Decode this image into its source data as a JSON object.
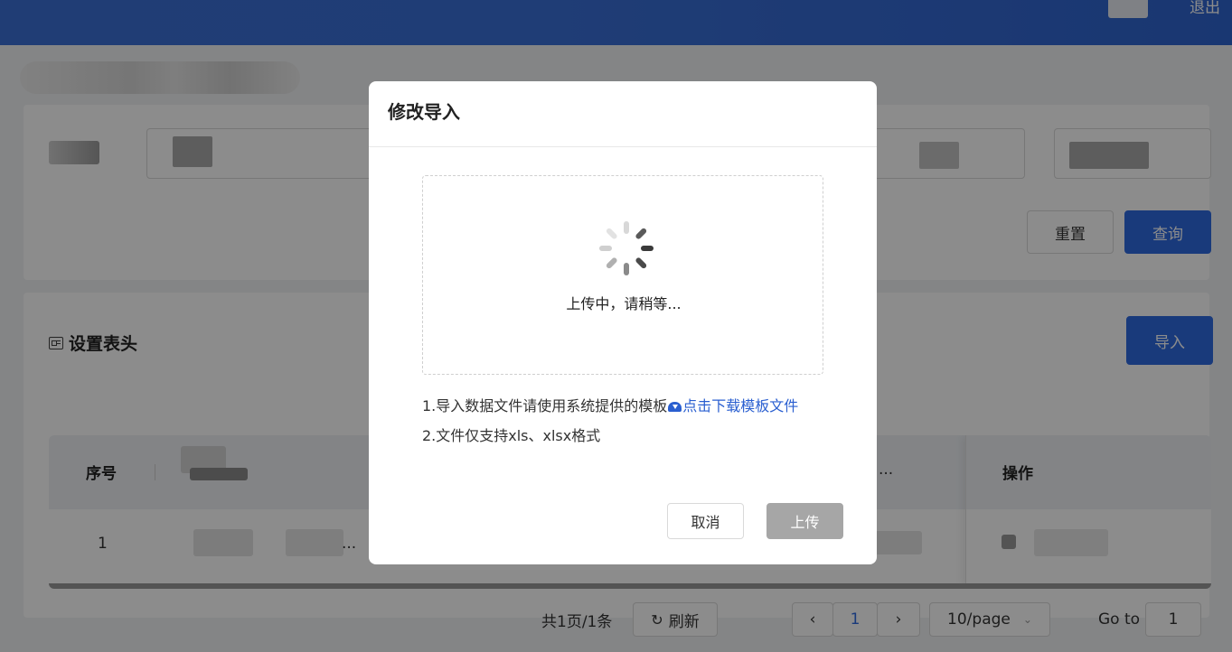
{
  "header": {
    "logout_label": "退出"
  },
  "filter": {
    "reset_label": "重置",
    "search_label": "查询"
  },
  "table_section": {
    "title": "设置表头",
    "import_label": "导入",
    "columns": {
      "index": "序号",
      "ops": "操作",
      "ellipsis": "..."
    },
    "rows": [
      {
        "index": "1",
        "ellipsis": "..."
      }
    ]
  },
  "pagination": {
    "summary": "共1页/1条",
    "refresh_label": "刷新",
    "current_page": "1",
    "page_size": "10/page",
    "goto_label": "Go to",
    "goto_value": "1"
  },
  "modal": {
    "title": "修改导入",
    "uploading_text": "上传中，请稍等...",
    "hint1_prefix": "1.导入数据文件请使用系统提供的模板",
    "hint1_link": "点击下载模板文件",
    "hint2": "2.文件仅支持xls、xlsx格式",
    "cancel_label": "取消",
    "upload_label": "上传"
  },
  "colors": {
    "primary": "#2f6be0",
    "link": "#2a5fd0",
    "disabled": "#a6a6a6"
  }
}
